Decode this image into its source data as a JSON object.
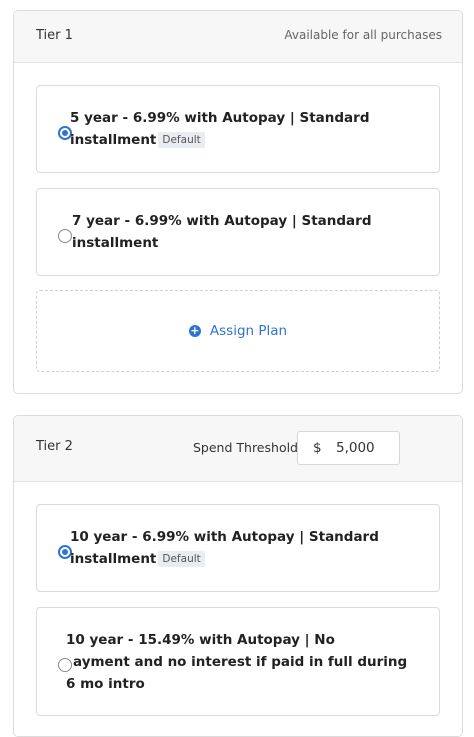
{
  "tier1": {
    "title": "Tier 1",
    "note": "Available for all purchases",
    "plans": [
      {
        "line1": "5 year - 6.99% with Autopay | Standard",
        "line2": "installment",
        "badge": "Default",
        "selected": true
      },
      {
        "line1": "7 year - 6.99% with Autopay | Standard",
        "line2": "installment",
        "badge": "",
        "selected": false
      }
    ],
    "assign_label": "Assign Plan"
  },
  "tier2": {
    "title": "Tier 2",
    "threshold_label": "Spend Threshold",
    "currency_symbol": "$",
    "threshold_value": "5,000",
    "plans": [
      {
        "line1": "10 year - 6.99% with Autopay | Standard",
        "line2": "installment",
        "badge": "Default",
        "selected": true
      },
      {
        "line1": "10 year - 15.49% with Autopay | No",
        "line2": "ayment and no interest if paid in full during",
        "line3": "6 mo intro",
        "badge": "",
        "selected": false
      }
    ]
  },
  "colors": {
    "accent": "#2f74d0",
    "header_bg": "#f7f7f7",
    "border": "#dcdcdc"
  },
  "icons": {
    "assign": "plus-circle-icon"
  }
}
